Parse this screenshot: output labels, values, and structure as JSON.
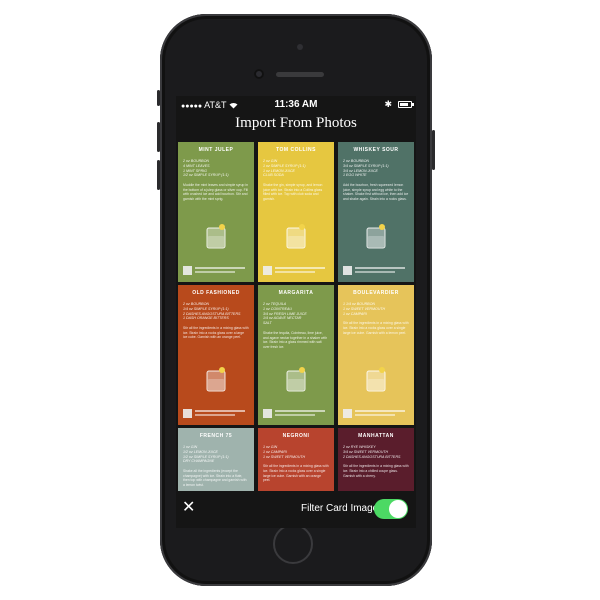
{
  "status_bar": {
    "carrier": "AT&T",
    "time": "11:36 AM",
    "bluetooth_icon": "bluetooth-icon",
    "battery_icon": "battery-icon",
    "wifi_icon": "wifi-icon"
  },
  "header": {
    "title": "Import From Photos"
  },
  "cards": [
    {
      "name": "MINT JULEP",
      "color": "#7e9a4b",
      "ingredients": [
        "2 oz BOURBON",
        "4 MINT LEAVES",
        "1 MINT SPRIG",
        "1/2 oz SIMPLE SYRUP (1:1)"
      ],
      "description": "Muddle the mint leaves and simple syrup in the bottom of a julep glass or silver cup. Fill with crushed ice and add bourbon. Stir and garnish with the mint sprig."
    },
    {
      "name": "TOM COLLINS",
      "color": "#e6c740",
      "ingredients": [
        "2 oz GIN",
        "1 oz SIMPLE SYRUP (1:1)",
        "1 oz LEMON JUICE",
        "CLUB SODA"
      ],
      "description": "Shake the gin, simple syrup, and lemon juice with ice. Strain into a Collins glass filled with ice. Top with club soda and garnish."
    },
    {
      "name": "WHISKEY SOUR",
      "color": "#507267",
      "ingredients": [
        "2 oz BOURBON",
        "3/4 oz SIMPLE SYRUP (1:1)",
        "3/4 oz LEMON JUICE",
        "1 EGG WHITE"
      ],
      "description": "Add the bourbon, fresh squeezed lemon juice, simple syrup and egg white to the shaker. Shake first without ice, then add ice and shake again. Strain into a rocks glass."
    },
    {
      "name": "OLD FASHIONED",
      "color": "#b84a1c",
      "ingredients": [
        "2 oz BOURBON",
        "1/4 oz SIMPLE SYRUP (1:1)",
        "2 DASHES ANGOSTURA BITTERS",
        "1 DASH ORANGE BITTERS"
      ],
      "description": "Stir all the ingredients in a mixing glass with ice. Strain into a rocks glass over a large ice cube. Garnish with an orange peel."
    },
    {
      "name": "MARGARITA",
      "color": "#7e9a4b",
      "ingredients": [
        "2 oz TEQUILA",
        "1 oz COINTREAU",
        "3/4 oz FRESH LIME JUICE",
        "1/4 oz AGAVE NECTAR",
        "SALT"
      ],
      "description": "Shake the tequila, Cointreau, lime juice, and agave nectar together in a shaker with ice. Strain into a glass rimmed with salt over fresh ice."
    },
    {
      "name": "BOULEVARDIER",
      "color": "#e6c45a",
      "ingredients": [
        "1 1/4 oz BOURBON",
        "1 oz SWEET VERMOUTH",
        "1 oz CAMPARI"
      ],
      "description": "Stir all the ingredients in a mixing glass with ice. Strain into a rocks glass over a single large ice cube. Garnish with a lemon peel."
    },
    {
      "name": "FRENCH 75",
      "color": "#9fb3ad",
      "ingredients": [
        "1 oz GIN",
        "1/2 oz LEMON JUICE",
        "1/2 oz SIMPLE SYRUP (1:1)",
        "DRY CHAMPAGNE"
      ],
      "description": "Shake all the ingredients (except the champagne) with ice. Strain into a flute, then top with champagne and garnish with a lemon twist."
    },
    {
      "name": "NEGRONI",
      "color": "#b8442e",
      "ingredients": [
        "1 oz GIN",
        "1 oz CAMPARI",
        "1 oz SWEET VERMOUTH"
      ],
      "description": "Stir all the ingredients in a mixing glass with ice. Strain into a rocks glass over a single large ice cube. Garnish with an orange peel."
    },
    {
      "name": "MANHATTAN",
      "color": "#5a1d2c",
      "ingredients": [
        "2 oz RYE WHISKEY",
        "3/4 oz SWEET VERMOUTH",
        "2 DASHES ANGOSTURA BITTERS"
      ],
      "description": "Stir all the ingredients in a mixing glass with ice. Strain into a chilled coupe glass. Garnish with a cherry."
    }
  ],
  "footer": {
    "close_icon": "close-icon",
    "close_glyph": "✕",
    "filter_label": "Filter Card Images",
    "filter_on": true,
    "toggle_color": "#4cd964"
  }
}
